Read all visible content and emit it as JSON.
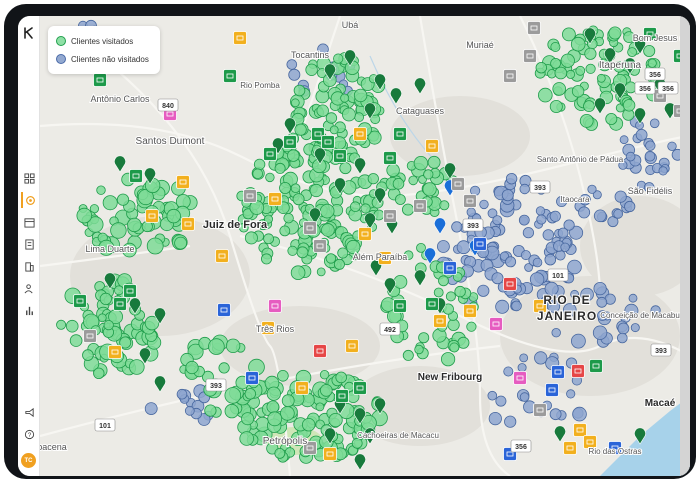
{
  "legend": {
    "visited_label": "Clientes visitados",
    "not_visited_label": "Clientes não visitados"
  },
  "colors": {
    "visited_fill": "#7fdc98",
    "visited_stroke": "#1e9c4a",
    "not_visited_fill": "#8ea6cf",
    "not_visited_stroke": "#47679f",
    "pin_green": "#187a3c",
    "pin_blue": "#1a6ed8",
    "badge_orange": "#f2b01e",
    "badge_green": "#1d9a4a",
    "badge_gray": "#9b9b9b",
    "badge_blue": "#2a64d8",
    "badge_red": "#e64646",
    "badge_pink": "#e65cc0",
    "road_shield": "#ffffff",
    "water": "#a7d2ea",
    "accent": "#f0a020"
  },
  "sidebar": {
    "logo_icon": "k-logo-icon",
    "items": [
      {
        "icon": "dashboard-icon"
      },
      {
        "icon": "map-location-icon",
        "active": true
      },
      {
        "icon": "calendar-icon"
      },
      {
        "icon": "form-icon"
      },
      {
        "icon": "building-icon"
      },
      {
        "icon": "users-icon"
      },
      {
        "icon": "bar-chart-icon"
      }
    ],
    "bottom": [
      {
        "icon": "megaphone-icon"
      },
      {
        "icon": "help-icon"
      }
    ],
    "avatar_initials": "TC"
  },
  "map": {
    "places": [
      {
        "name": "Ubá"
      },
      {
        "name": "Tocantins"
      },
      {
        "name": "Rio Pomba"
      },
      {
        "name": "Antônio Carlos"
      },
      {
        "name": "Santos Dumont"
      },
      {
        "name": "Muriaé"
      },
      {
        "name": "Itaperuna"
      },
      {
        "name": "Bom Jesus do Itabapoana"
      },
      {
        "name": "Cataguases"
      },
      {
        "name": "Juiz de Fora"
      },
      {
        "name": "Lima Duarte"
      },
      {
        "name": "Além Paraíba"
      },
      {
        "name": "Santo Antônio de Pádua"
      },
      {
        "name": "Itaocara"
      },
      {
        "name": "São Fidélis"
      },
      {
        "name": "Três Rios"
      },
      {
        "name": "RIO DE JANEIRO"
      },
      {
        "name": "Conceição de Macabu"
      },
      {
        "name": "New Fribourg"
      },
      {
        "name": "Macaé"
      },
      {
        "name": "Petrópolis"
      },
      {
        "name": "Cachoeiras de Macacu"
      },
      {
        "name": "Rio das Ostras"
      },
      {
        "name": "Barbacena"
      }
    ],
    "roads": [
      "840",
      "393",
      "492",
      "393",
      "393",
      "101",
      "101",
      "356",
      "393"
    ]
  }
}
